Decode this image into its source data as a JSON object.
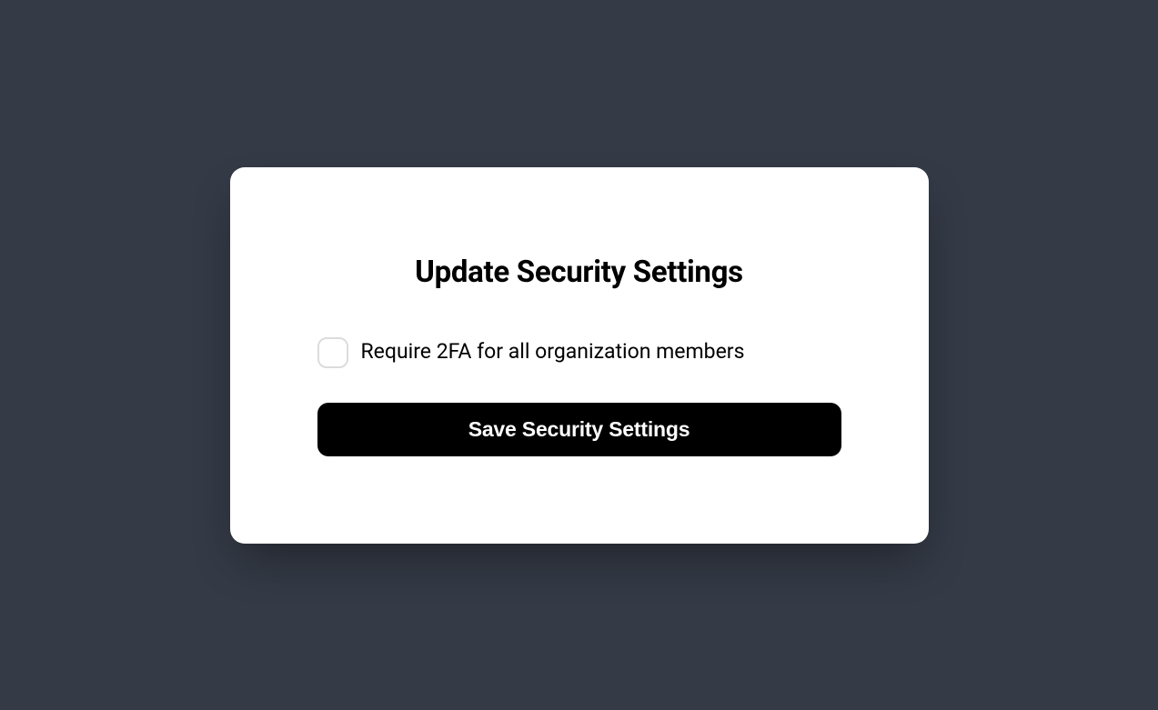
{
  "modal": {
    "title": "Update Security Settings",
    "checkbox": {
      "label": "Require 2FA for all organization members",
      "checked": false
    },
    "save_button_label": "Save Security Settings"
  },
  "colors": {
    "background": "#343a46",
    "modal_bg": "#ffffff",
    "button_bg": "#000000",
    "button_text": "#ffffff",
    "checkbox_border": "#dcdcdc"
  }
}
